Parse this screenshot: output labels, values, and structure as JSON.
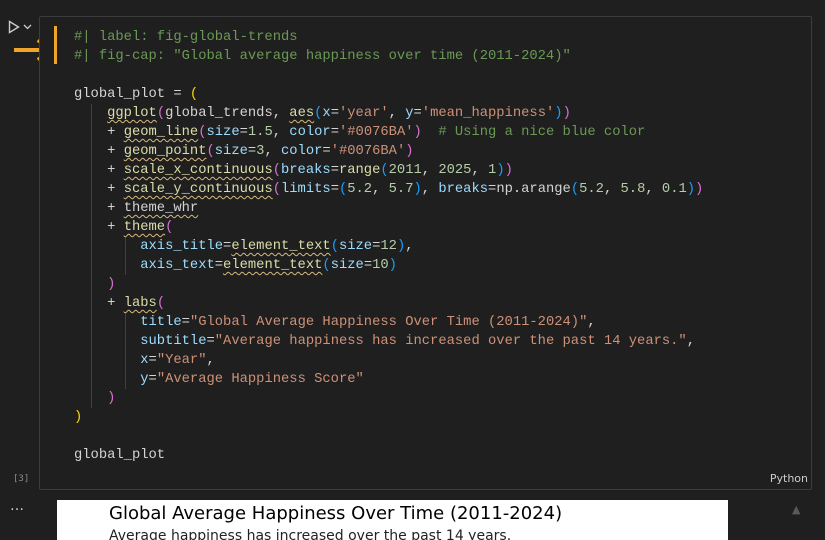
{
  "cell": {
    "execution_count": "[3]",
    "language": "Python",
    "code": {
      "l1": "#| label: fig-global-trends",
      "l2": "#| fig-cap: \"Global average happiness over time (2011-2024)\"",
      "l4_var": "global_plot",
      "l5_fn": "ggplot",
      "l5_df": "global_trends",
      "l5_aes": "aes",
      "l5_x": "'year'",
      "l5_y": "'mean_happiness'",
      "l6_fn": "geom_line",
      "l6_size": "1.5",
      "l6_color": "'#0076BA'",
      "l6_comment": "# Using a nice blue color",
      "l7_fn": "geom_point",
      "l7_size": "3",
      "l7_color": "'#0076BA'",
      "l8_fn": "scale_x_continuous",
      "l8_range": "range",
      "l8_a": "2011",
      "l8_b": "2025",
      "l8_c": "1",
      "l9_fn": "scale_y_continuous",
      "l9_l1": "5.2",
      "l9_l2": "5.7",
      "l9_np": "np.arange",
      "l9_b1": "5.2",
      "l9_b2": "5.8",
      "l9_b3": "0.1",
      "l10_fn": "theme_whr",
      "l11_fn": "theme",
      "l12_key": "axis_title",
      "l12_fn": "element_text",
      "l12_size": "12",
      "l13_key": "axis_text",
      "l13_fn": "element_text",
      "l13_size": "10",
      "l15_fn": "labs",
      "l16_key": "title",
      "l16_val": "\"Global Average Happiness Over Time (2011-2024)\"",
      "l17_key": "subtitle",
      "l17_val": "\"Average happiness has increased over the past 14 years.\"",
      "l18_key": "x",
      "l18_val": "\"Year\"",
      "l19_key": "y",
      "l19_val": "\"Average Happiness Score\"",
      "l22_var": "global_plot"
    }
  },
  "output": {
    "title": "Global Average Happiness Over Time (2011-2024)",
    "subtitle": "Average happiness has increased over the past 14 years."
  },
  "colors": {
    "accent": "#f0a42a",
    "background": "#1f1f1f"
  },
  "icons": {
    "run": "play-icon",
    "run_menu": "chevron-down-icon",
    "current": "arrow-right-icon",
    "output_menu": "ellipsis-icon",
    "scroll": "triangle-up-icon"
  }
}
